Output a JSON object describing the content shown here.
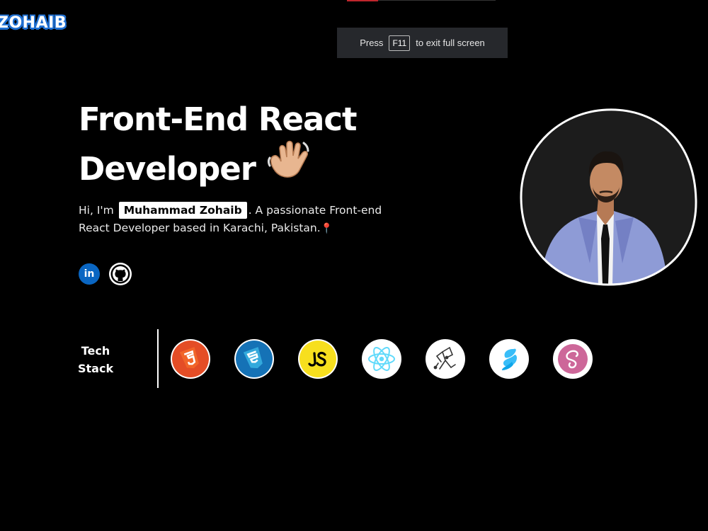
{
  "brand": {
    "logo_text": "ZOHAIB"
  },
  "fullscreen_banner": {
    "prefix": "Press",
    "key": "F11",
    "suffix": "to exit full screen"
  },
  "hero": {
    "title_line1": "Front-End React",
    "title_line2": "Developer",
    "intro_before": "Hi, I'm",
    "name": "Muhammad Zohaib",
    "intro_after": ". A passionate Front-end React Developer based in Karachi, Pakistan.",
    "pin": "📍"
  },
  "socials": [
    {
      "icon": "linkedin-icon",
      "label": "in",
      "color": "#0a66c2"
    },
    {
      "icon": "github-icon"
    }
  ],
  "tech_stack": {
    "label_line1": "Tech",
    "label_line2": "Stack",
    "items": [
      {
        "icon": "html5-icon",
        "color": "#e44d26"
      },
      {
        "icon": "css3-icon",
        "color": "#1572b6"
      },
      {
        "icon": "javascript-icon",
        "color": "#f7df1e"
      },
      {
        "icon": "react-icon",
        "color": "#61dafb"
      },
      {
        "icon": "redux-icon",
        "color": "#333333"
      },
      {
        "icon": "tailwind-icon",
        "color": "#38bdf8"
      },
      {
        "icon": "sass-icon",
        "color": "#cd6799"
      }
    ]
  },
  "colors": {
    "background": "#000000",
    "accent_blue": "#1f6fd1",
    "text": "#ffffff"
  }
}
